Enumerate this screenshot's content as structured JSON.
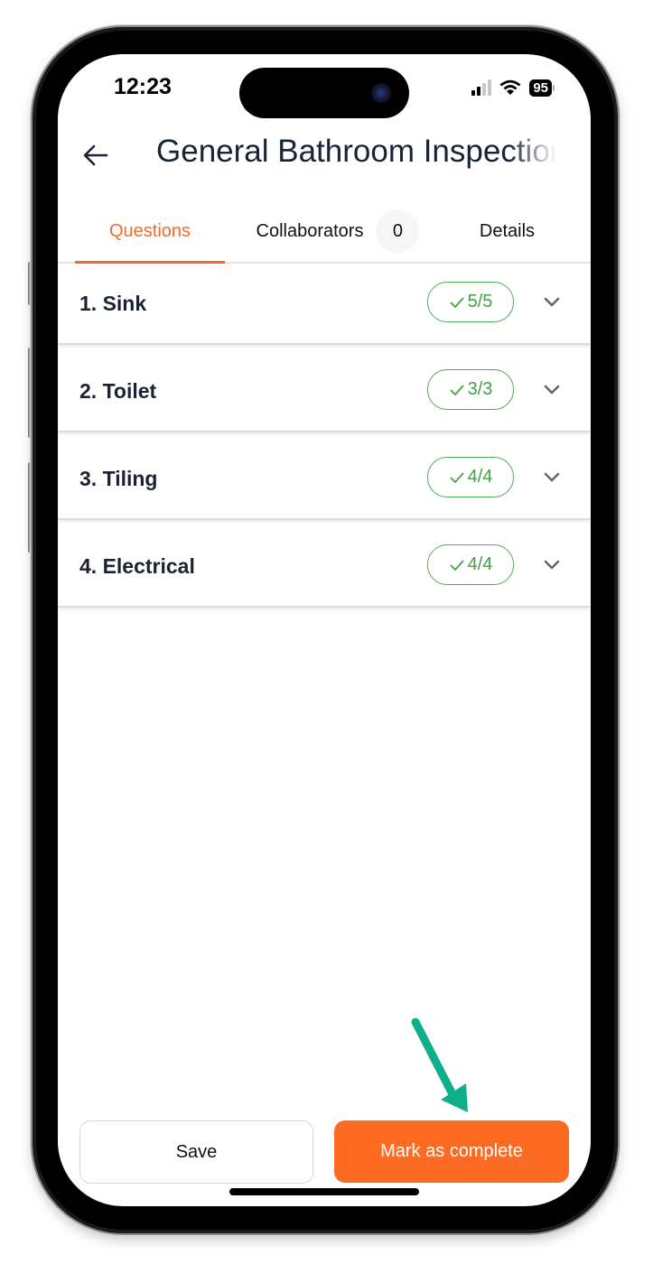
{
  "status_bar": {
    "time": "12:23",
    "battery": "95"
  },
  "header": {
    "title": "General Bathroom Inspection"
  },
  "tabs": [
    {
      "label": "Questions",
      "active": true
    },
    {
      "label": "Collaborators",
      "count": "0",
      "active": false
    },
    {
      "label": "Details",
      "active": false
    }
  ],
  "sections": [
    {
      "title": "1. Sink",
      "progress": "5/5"
    },
    {
      "title": "2. Toilet",
      "progress": "3/3"
    },
    {
      "title": "3. Tiling",
      "progress": "4/4"
    },
    {
      "title": "4. Electrical",
      "progress": "4/4"
    }
  ],
  "footer": {
    "save_label": "Save",
    "complete_label": "Mark as complete"
  },
  "colors": {
    "accent": "#f26b2a",
    "primary_button": "#fd6a22",
    "success": "#43a047",
    "annotation_arrow": "#0eaf8a"
  }
}
